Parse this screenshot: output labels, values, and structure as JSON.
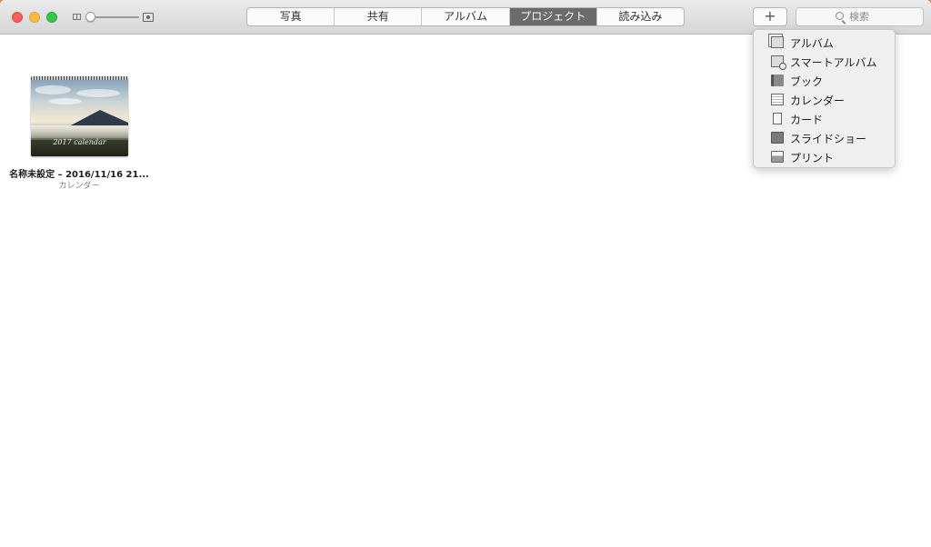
{
  "toolbar": {
    "tabs": [
      {
        "label": "写真",
        "active": false
      },
      {
        "label": "共有",
        "active": false
      },
      {
        "label": "アルバム",
        "active": false
      },
      {
        "label": "プロジェクト",
        "active": true
      },
      {
        "label": "読み込み",
        "active": false
      }
    ],
    "add_label": "+",
    "search": {
      "placeholder": "検索",
      "value": ""
    }
  },
  "projects": [
    {
      "thumbnail_text": "2017 calendar",
      "title": "名称未設定 – 2016/11/16 21...",
      "type": "カレンダー"
    }
  ],
  "add_menu": {
    "items": [
      {
        "label": "アルバム",
        "icon": "album-icon"
      },
      {
        "label": "スマートアルバム",
        "icon": "smart-album-icon"
      },
      {
        "label": "ブック",
        "icon": "book-icon"
      },
      {
        "label": "カレンダー",
        "icon": "calendar-icon"
      },
      {
        "label": "カード",
        "icon": "card-icon"
      },
      {
        "label": "スライドショー",
        "icon": "slideshow-icon"
      },
      {
        "label": "プリント",
        "icon": "print-icon"
      }
    ]
  },
  "colors": {
    "active_tab": "#6b6b6b",
    "desktop": "#d98a4a"
  }
}
